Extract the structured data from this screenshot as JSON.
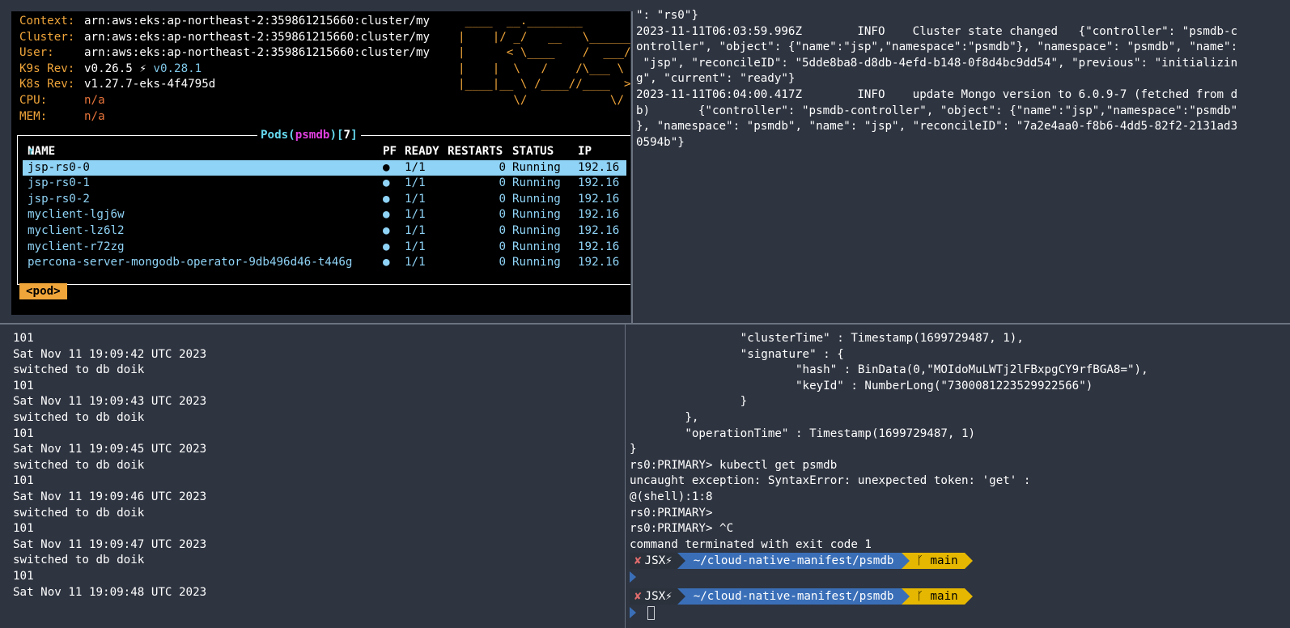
{
  "k9s": {
    "header": [
      {
        "label": "Context:",
        "value": "arn:aws:eks:ap-northeast-2:359861215660:cluster/my"
      },
      {
        "label": "Cluster:",
        "value": "arn:aws:eks:ap-northeast-2:359861215660:cluster/my"
      },
      {
        "label": "User:",
        "value": "arn:aws:eks:ap-northeast-2:359861215660:cluster/my"
      },
      {
        "label": "K9s Rev:",
        "value": "v0.26.5 ⚡",
        "value2": "v0.28.1"
      },
      {
        "label": "K8s Rev:",
        "value": "v1.27.7-eks-4f4795d"
      },
      {
        "label": "CPU:",
        "value": "n/a"
      },
      {
        "label": "MEM:",
        "value": "n/a"
      }
    ],
    "logo_lines": [
      " ____  __.________       ",
      "|    |/ _/   __   \\______",
      "|      < \\____    /  ___/",
      "|    |  \\   /    /\\___ \\ ",
      "|____|__ \\ /____//____  >",
      "        \\/            \\/ "
    ],
    "pods_title": {
      "prefix": "Pods(",
      "namespace": "psmdb",
      "middle": ")[",
      "count": "7",
      "suffix": "]"
    },
    "columns": {
      "name": "NAME",
      "sort": "↑",
      "pf": "PF",
      "ready": "READY",
      "restarts": "RESTARTS",
      "status": "STATUS",
      "ip": "IP"
    },
    "pods": [
      {
        "name": "jsp-rs0-0",
        "pf": "●",
        "ready": "1/1",
        "restarts": "0",
        "status": "Running",
        "ip": "192.16"
      },
      {
        "name": "jsp-rs0-1",
        "pf": "●",
        "ready": "1/1",
        "restarts": "0",
        "status": "Running",
        "ip": "192.16"
      },
      {
        "name": "jsp-rs0-2",
        "pf": "●",
        "ready": "1/1",
        "restarts": "0",
        "status": "Running",
        "ip": "192.16"
      },
      {
        "name": "myclient-lgj6w",
        "pf": "●",
        "ready": "1/1",
        "restarts": "0",
        "status": "Running",
        "ip": "192.16"
      },
      {
        "name": "myclient-lz6l2",
        "pf": "●",
        "ready": "1/1",
        "restarts": "0",
        "status": "Running",
        "ip": "192.16"
      },
      {
        "name": "myclient-r72zg",
        "pf": "●",
        "ready": "1/1",
        "restarts": "0",
        "status": "Running",
        "ip": "192.16"
      },
      {
        "name": "percona-server-mongodb-operator-9db496d46-t446g",
        "pf": "●",
        "ready": "1/1",
        "restarts": "0",
        "status": "Running",
        "ip": "192.16"
      }
    ],
    "crumb": "<pod>"
  },
  "operator_log": [
    "\": \"rs0\"}",
    "2023-11-11T06:03:59.996Z        INFO    Cluster state changed   {\"controller\": \"psmdb-c",
    "ontroller\", \"object\": {\"name\":\"jsp\",\"namespace\":\"psmdb\"}, \"namespace\": \"psmdb\", \"name\":",
    " \"jsp\", \"reconcileID\": \"5dde8ba8-d8db-4efd-b148-0f8d4bc9dd54\", \"previous\": \"initializin",
    "g\", \"current\": \"ready\"}",
    "2023-11-11T06:04:00.417Z        INFO    update Mongo version to 6.0.9-7 (fetched from d",
    "b)       {\"controller\": \"psmdb-controller\", \"object\": {\"name\":\"jsp\",\"namespace\":\"psmdb\"",
    "}, \"namespace\": \"psmdb\", \"name\": \"jsp\", \"reconcileID\": \"7a2e4aa0-f8b6-4dd5-82f2-2131ad3",
    "0594b\"}"
  ],
  "watch_output": [
    "101",
    "Sat Nov 11 19:09:42 UTC 2023",
    "switched to db doik",
    "101",
    "Sat Nov 11 19:09:43 UTC 2023",
    "switched to db doik",
    "101",
    "Sat Nov 11 19:09:45 UTC 2023",
    "switched to db doik",
    "101",
    "Sat Nov 11 19:09:46 UTC 2023",
    "switched to db doik",
    "101",
    "Sat Nov 11 19:09:47 UTC 2023",
    "switched to db doik",
    "101",
    "Sat Nov 11 19:09:48 UTC 2023"
  ],
  "mongo_output": [
    "                \"clusterTime\" : Timestamp(1699729487, 1),",
    "                \"signature\" : {",
    "                        \"hash\" : BinData(0,\"MOIdoMuLWTj2lFBxpgCY9rfBGA8=\"),",
    "                        \"keyId\" : NumberLong(\"7300081223529922566\")",
    "                }",
    "        },",
    "        \"operationTime\" : Timestamp(1699729487, 1)",
    "}",
    "rs0:PRIMARY> kubectl get psmdb",
    "uncaught exception: SyntaxError: unexpected token: 'get' :",
    "@(shell):1:8",
    "rs0:PRIMARY>",
    "rs0:PRIMARY> ^C",
    "command terminated with exit code 1"
  ],
  "shell_prompt": {
    "status_icon": "✘",
    "user": "JSX⚡",
    "path": "~/cloud-native-manifest/psmdb",
    "branch_icon": "ᚴ",
    "branch": "main"
  },
  "colors": {
    "k9s_orange": "#f0a53a",
    "k9s_cyan": "#8fd3f6",
    "namespace_magenta": "#e040e0",
    "terminal_bg": "#2e3440",
    "prompt_path_bg": "#3a6fb8",
    "prompt_git_bg": "#e5b700"
  }
}
